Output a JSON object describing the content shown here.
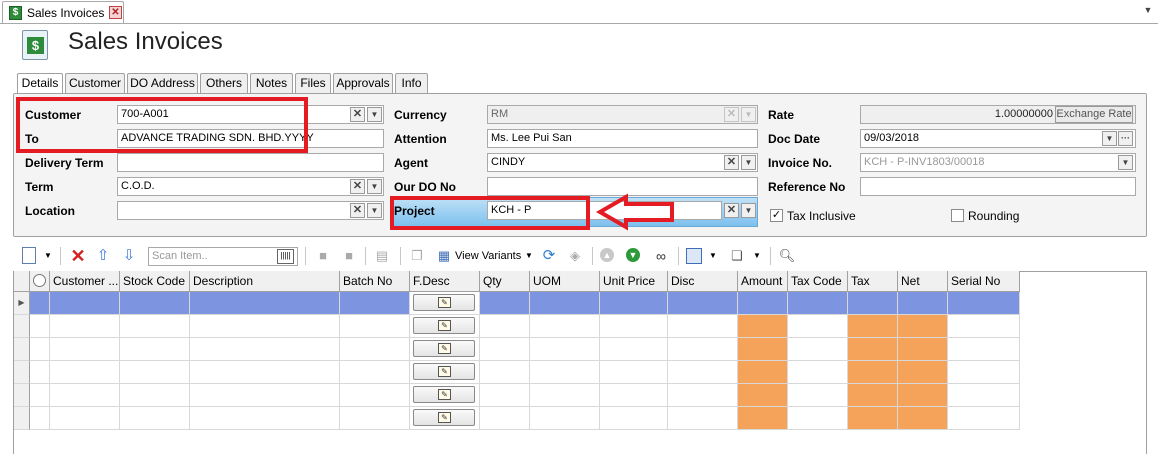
{
  "window": {
    "tab_title": "Sales Invoices",
    "page_title": "Sales Invoices",
    "doc_icon": "dollar-document-icon",
    "close_icon": "close-icon"
  },
  "tabs": [
    "Details",
    "Customer",
    "DO Address",
    "Others",
    "Notes",
    "Files",
    "Approvals",
    "Info"
  ],
  "form": {
    "customer": {
      "label": "Customer",
      "value": "700-A001"
    },
    "to": {
      "label": "To",
      "value": "ADVANCE TRADING SDN. BHD.YYYY"
    },
    "delivery_term": {
      "label": "Delivery Term",
      "value": ""
    },
    "term": {
      "label": "Term",
      "value": "C.O.D."
    },
    "location": {
      "label": "Location",
      "value": ""
    },
    "currency": {
      "label": "Currency",
      "value": "RM"
    },
    "attention": {
      "label": "Attention",
      "value": "Ms. Lee Pui San"
    },
    "agent": {
      "label": "Agent",
      "value": "CINDY"
    },
    "our_do_no": {
      "label": "Our DO No",
      "value": ""
    },
    "project": {
      "label": "Project",
      "value": "KCH - P"
    },
    "rate": {
      "label": "Rate",
      "value": "1.00000000"
    },
    "exchange_rate_button": "Exchange Rate",
    "doc_date": {
      "label": "Doc Date",
      "value": "09/03/2018"
    },
    "invoice_no": {
      "label": "Invoice No.",
      "value": "KCH - P-INV1803/00018"
    },
    "reference_no": {
      "label": "Reference No",
      "value": ""
    },
    "tax_inclusive": {
      "label": "Tax Inclusive",
      "checked": true
    },
    "rounding": {
      "label": "Rounding",
      "checked": false
    }
  },
  "toolbar": {
    "scan_placeholder": "Scan Item..",
    "view_variants": "View Variants"
  },
  "grid": {
    "columns": [
      "Customer ...",
      "Stock Code",
      "Description",
      "Batch No",
      "F.Desc",
      "Qty",
      "UOM",
      "Unit Price",
      "Disc",
      "Amount",
      "Tax Code",
      "Tax",
      "Net",
      "Serial No"
    ],
    "row_count": 6,
    "highlight_colors": {
      "selected_row": "#7d95e0",
      "computed_cells": "#f5a25b"
    }
  },
  "annotations": {
    "highlight_color": "#e41b23"
  }
}
